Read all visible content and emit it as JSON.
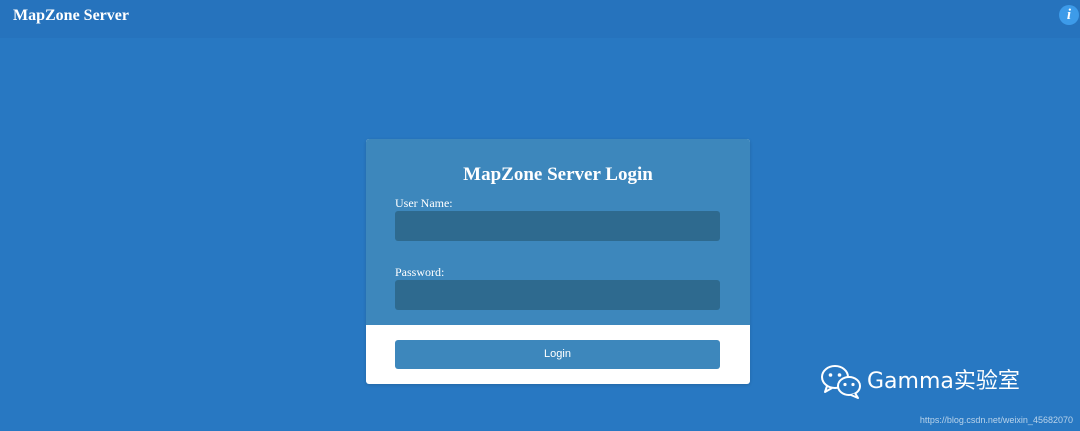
{
  "header": {
    "app_title": "MapZone Server",
    "info_icon": "i"
  },
  "login": {
    "title": "MapZone Server Login",
    "username_label": "User Name:",
    "username_value": "",
    "password_label": "Password:",
    "password_value": "",
    "submit_label": "Login"
  },
  "watermark": {
    "logo_icon": "wechat-icon",
    "text": "Gamma实验室",
    "source_url": "https://blog.csdn.net/weixin_45682070"
  },
  "colors": {
    "background": "#2878c2",
    "header_bar": "#2673bd",
    "card_panel": "#3d87bc",
    "input_fill": "#2e6a8f",
    "button_fill": "#3d87bc",
    "info_icon": "#3d9be9"
  }
}
